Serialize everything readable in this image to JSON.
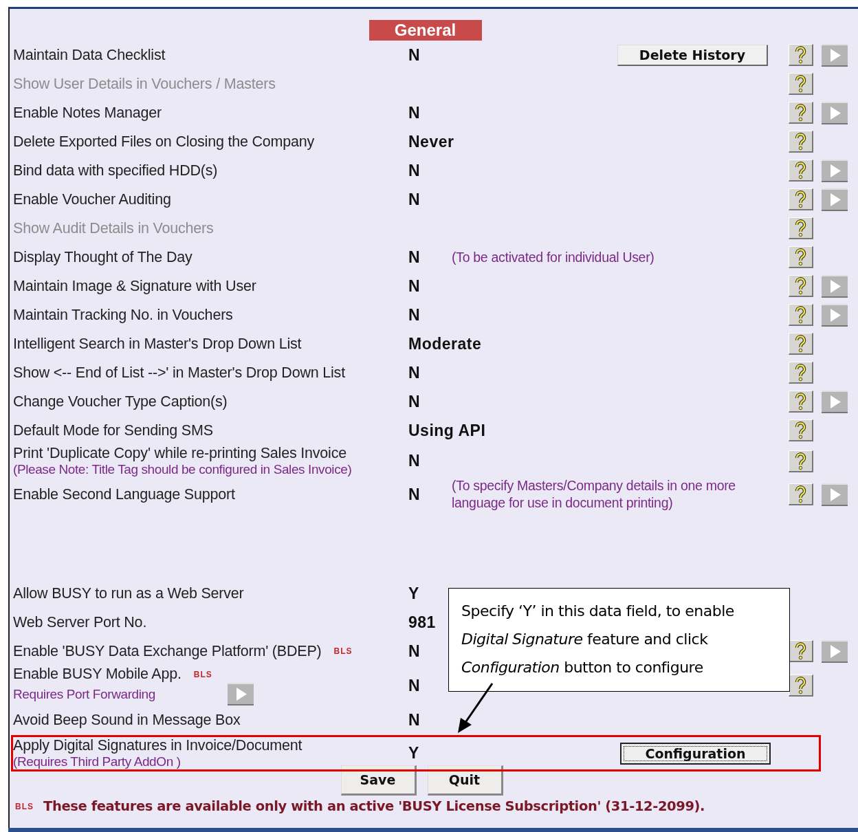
{
  "section_title": "General",
  "rows": [
    {
      "label": "Maintain Data Checklist",
      "disabled": false,
      "value": "N",
      "button": "Delete History",
      "help": true,
      "arrow": true
    },
    {
      "label": "Show User Details in Vouchers / Masters",
      "disabled": true,
      "help": true,
      "arrow": false
    },
    {
      "label": "Enable Notes Manager",
      "disabled": false,
      "value": "N",
      "help": true,
      "arrow": true
    },
    {
      "label": "Delete Exported Files on Closing the Company",
      "disabled": false,
      "value": "Never",
      "help": true,
      "arrow": false
    },
    {
      "label": "Bind data with specified HDD(s)",
      "disabled": false,
      "value": "N",
      "help": true,
      "arrow": true
    },
    {
      "label": "Enable Voucher Auditing",
      "disabled": false,
      "value": "N",
      "help": true,
      "arrow": true
    },
    {
      "label": "Show Audit Details in Vouchers",
      "disabled": true,
      "help": true,
      "arrow": false
    },
    {
      "label": "Display Thought of The Day",
      "disabled": false,
      "value": "N",
      "note": "(To be activated for individual User)",
      "help": true,
      "arrow": false
    },
    {
      "label": "Maintain Image & Signature with User",
      "disabled": false,
      "value": "N",
      "help": true,
      "arrow": true
    },
    {
      "label": "Maintain Tracking No. in Vouchers",
      "disabled": false,
      "value": "N",
      "help": true,
      "arrow": true
    },
    {
      "label": "Intelligent Search in Master's Drop Down List",
      "disabled": false,
      "value": "Moderate",
      "help": true,
      "arrow": false
    },
    {
      "label": "Show <-- End of List -->' in Master's Drop Down List",
      "disabled": false,
      "value": "N",
      "help": true,
      "arrow": false
    },
    {
      "label": "Change Voucher Type Caption(s)",
      "disabled": false,
      "value": "N",
      "help": true,
      "arrow": true
    },
    {
      "label": "Default Mode for Sending SMS",
      "disabled": false,
      "value": "Using API",
      "help": true,
      "arrow": false
    },
    {
      "label": "Print 'Duplicate Copy' while re-printing Sales Invoice",
      "disabled": false,
      "value": "N",
      "sublabel": "(Please Note: Title Tag should be configured in Sales Invoice)",
      "help": true,
      "arrow": false
    },
    {
      "label": "Enable Second Language Support",
      "disabled": false,
      "value": "N",
      "note": "(To specify Masters/Company details in one more language for use in document printing)",
      "help": true,
      "arrow": true
    }
  ],
  "more_rows": [
    {
      "label": "Allow BUSY to run as a Web Server",
      "disabled": false,
      "value": "Y",
      "help": false,
      "arrow": false
    },
    {
      "label": "Web Server Port No.",
      "disabled": false,
      "value": "981",
      "help": false,
      "arrow": false
    },
    {
      "label": "Enable 'BUSY Data Exchange Platform' (BDEP)",
      "badge": "BLS",
      "disabled": false,
      "value": "N",
      "help": true,
      "arrow": true
    },
    {
      "label": "Enable BUSY Mobile App.",
      "badge": "BLS",
      "disabled": false,
      "value": "N",
      "sublabel": "Requires Port Forwarding",
      "inline_arrow": true,
      "help": true,
      "arrow": false
    },
    {
      "label": "Avoid Beep Sound in Message Box",
      "disabled": false,
      "value": "N",
      "help": false,
      "arrow": false
    },
    {
      "label": "Apply Digital Signatures in Invoice/Document",
      "disabled": false,
      "value": "Y",
      "sublabel": "(Requires Third Party AddOn )",
      "button": "Configuration",
      "focused": true,
      "highlighted": true,
      "help": false,
      "arrow": false
    }
  ],
  "buttons": [
    "Save",
    "Quit"
  ],
  "footer": {
    "badge": "BLS",
    "text": "These features are available only with an active 'BUSY License Subscription' (31-12-2099)."
  },
  "callout": {
    "text": "Specify ‘Y’ in this data field, to enable *Digital Signature* feature and click *Configuration* button to configure"
  }
}
